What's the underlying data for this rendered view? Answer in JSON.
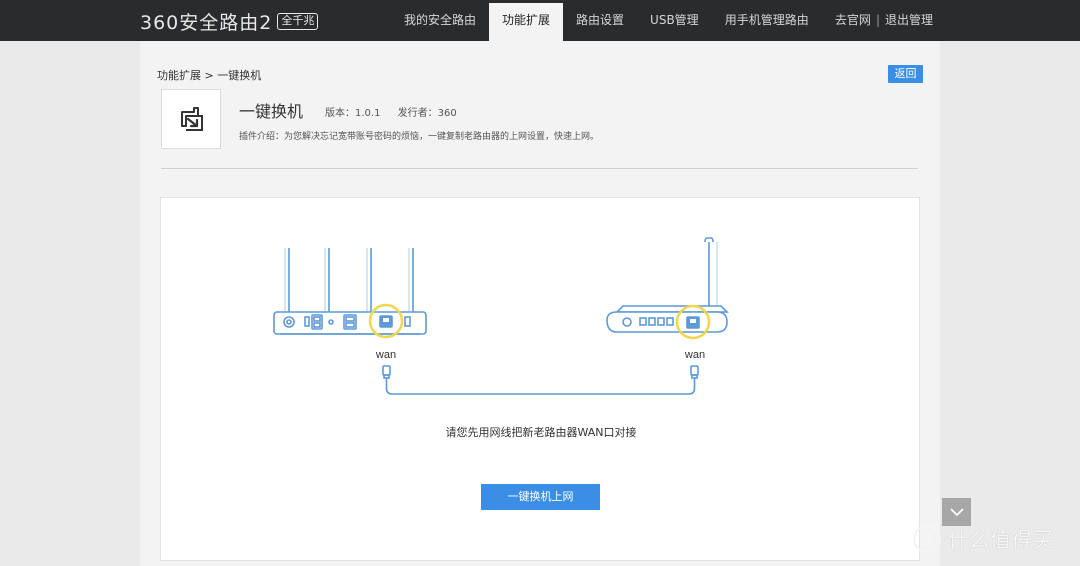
{
  "header": {
    "logo_text": "360安全路由2",
    "logo_badge": "全千兆",
    "nav": [
      {
        "label": "我的安全路由",
        "active": false
      },
      {
        "label": "功能扩展",
        "active": true
      },
      {
        "label": "路由设置",
        "active": false
      },
      {
        "label": "USB管理",
        "active": false
      },
      {
        "label": "用手机管理路由",
        "active": false
      }
    ],
    "official_site": "去官网",
    "separator": "|",
    "logout": "退出管理"
  },
  "breadcrumb": "功能扩展 > 一键换机",
  "back_label": "返回",
  "plugin": {
    "icon": "swap-icon",
    "name": "一键换机",
    "version": "版本：1.0.1",
    "publisher": "发行者：360",
    "description": "插件介绍：为您解决忘记宽带账号密码的烦恼，一键复制老路由器的上网设置，快速上网。"
  },
  "diagram": {
    "left_port_label": "wan",
    "right_port_label": "wan",
    "highlight_color": "#f2d74e",
    "line_color": "#5d9ad6"
  },
  "instruction": "请您先用网线把新老路由器WAN口对接",
  "action_button": "一键换机上网",
  "scroll_icon": "chevron-down-icon",
  "watermark": {
    "text": "什么值得买",
    "icon": "zhi-logo-icon"
  },
  "colors": {
    "topbar": "#2a2b2d",
    "accent": "#3a8ee6"
  }
}
